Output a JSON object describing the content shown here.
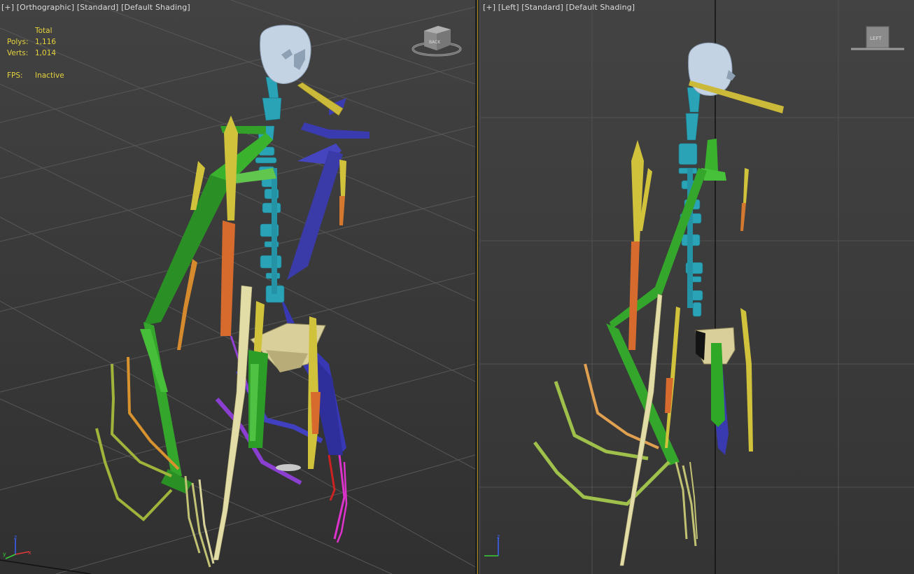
{
  "viewport_left": {
    "label_plus": "[+]",
    "label_view": "[Orthographic]",
    "label_mode": "[Standard]",
    "label_shading": "[Default Shading]",
    "viewcube_face": "BACK",
    "stats": {
      "total_label": "Total",
      "polys_label": "Polys:",
      "polys_value": "1,116",
      "verts_label": "Verts:",
      "verts_value": "1,014",
      "fps_label": "FPS:",
      "fps_value": "Inactive"
    }
  },
  "viewport_right": {
    "label_plus": "[+]",
    "label_view": "[Left]",
    "label_mode": "[Standard]",
    "label_shading": "[Default Shading]",
    "viewcube_face": "LEFT"
  },
  "colors": {
    "stats_text": "#e6d33c",
    "active_border": "#b5931a",
    "spine": "#27a5b8",
    "right_arm": "#2a8a22",
    "left_arm": "#3a3ab0",
    "clavicle": "#c9b534"
  }
}
